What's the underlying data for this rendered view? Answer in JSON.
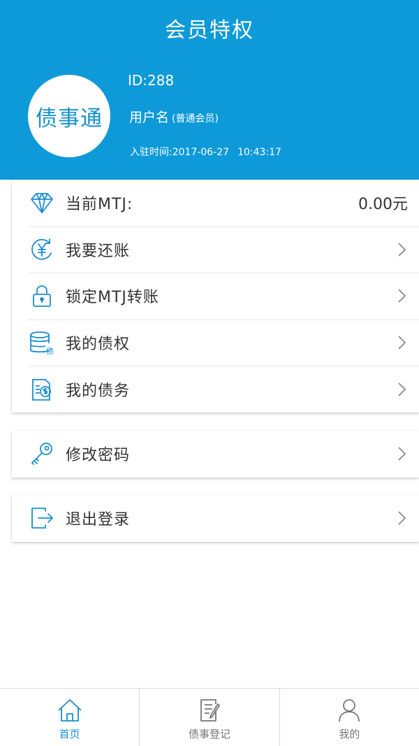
{
  "header": {
    "title": "会员特权",
    "avatar_text": "债事通",
    "user_id": "ID:288",
    "username": "用户名",
    "member_level": "(普通会员)",
    "join_label": "入驻时间:2017-06-27",
    "join_time": "10:43:17"
  },
  "menu": {
    "balance_label": "当前MTJ:",
    "balance_value": "0.00元",
    "items": [
      {
        "label": "我要还账",
        "icon": "yen-cycle-icon"
      },
      {
        "label": "锁定MTJ转账",
        "icon": "lock-icon"
      },
      {
        "label": "我的债权",
        "icon": "database-debt-icon"
      },
      {
        "label": "我的债务",
        "icon": "document-dollar-icon"
      }
    ]
  },
  "settings": {
    "change_password": "修改密码"
  },
  "logout": {
    "label": "退出登录"
  },
  "tabbar": {
    "tabs": [
      {
        "label": "首页",
        "icon": "home-icon",
        "active": true
      },
      {
        "label": "债事登记",
        "icon": "edit-document-icon",
        "active": false
      },
      {
        "label": "我的",
        "icon": "user-icon",
        "active": false
      }
    ]
  },
  "colors": {
    "primary": "#0e9ad9",
    "icon_blue": "#1a8ed0",
    "tab_gray": "#777777"
  }
}
